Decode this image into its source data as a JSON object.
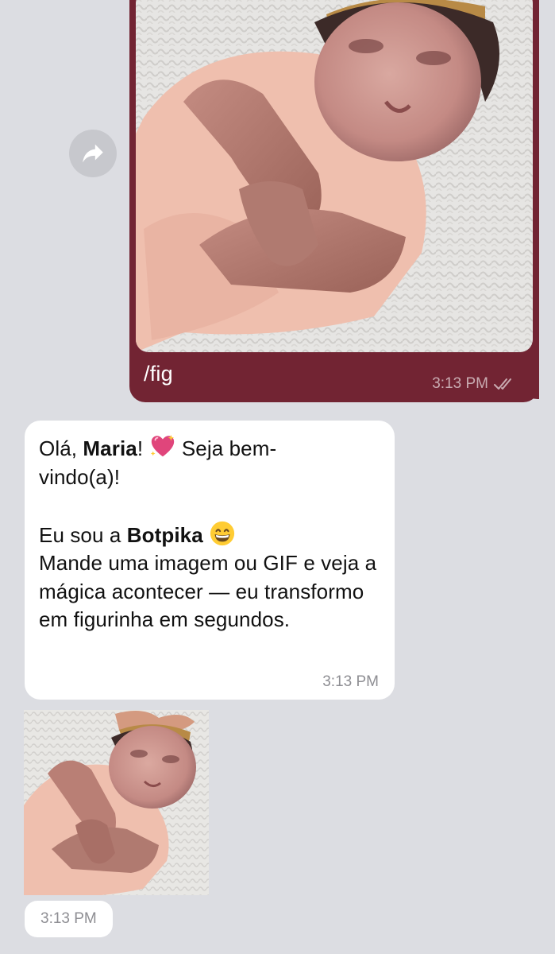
{
  "outgoing": {
    "caption": "/fig",
    "time": "3:13 PM",
    "status": "read"
  },
  "incoming": {
    "greeting_prefix": "Olá, ",
    "greeting_name": "Maria",
    "greeting_after": "!",
    "greeting_emoji": "sparkling-heart",
    "greeting_rest": " Seja bem-",
    "greeting_line2": "vindo(a)!",
    "intro_prefix": "Eu sou a ",
    "bot_name": "Botpika",
    "intro_emoji": "grinning-face",
    "body": "Mande uma imagem ou GIF e veja a mágica acontecer — eu transformo em figurinha em segundos.",
    "time": "3:13 PM"
  },
  "sticker": {
    "time": "3:13 PM"
  },
  "icons": {
    "forward": "forward-icon",
    "read_receipt": "double-check-icon"
  },
  "colors": {
    "background": "#dcdde2",
    "outgoing_bubble": "#722433",
    "incoming_bubble": "#ffffff",
    "timestamp_gray": "#8e8e93"
  }
}
